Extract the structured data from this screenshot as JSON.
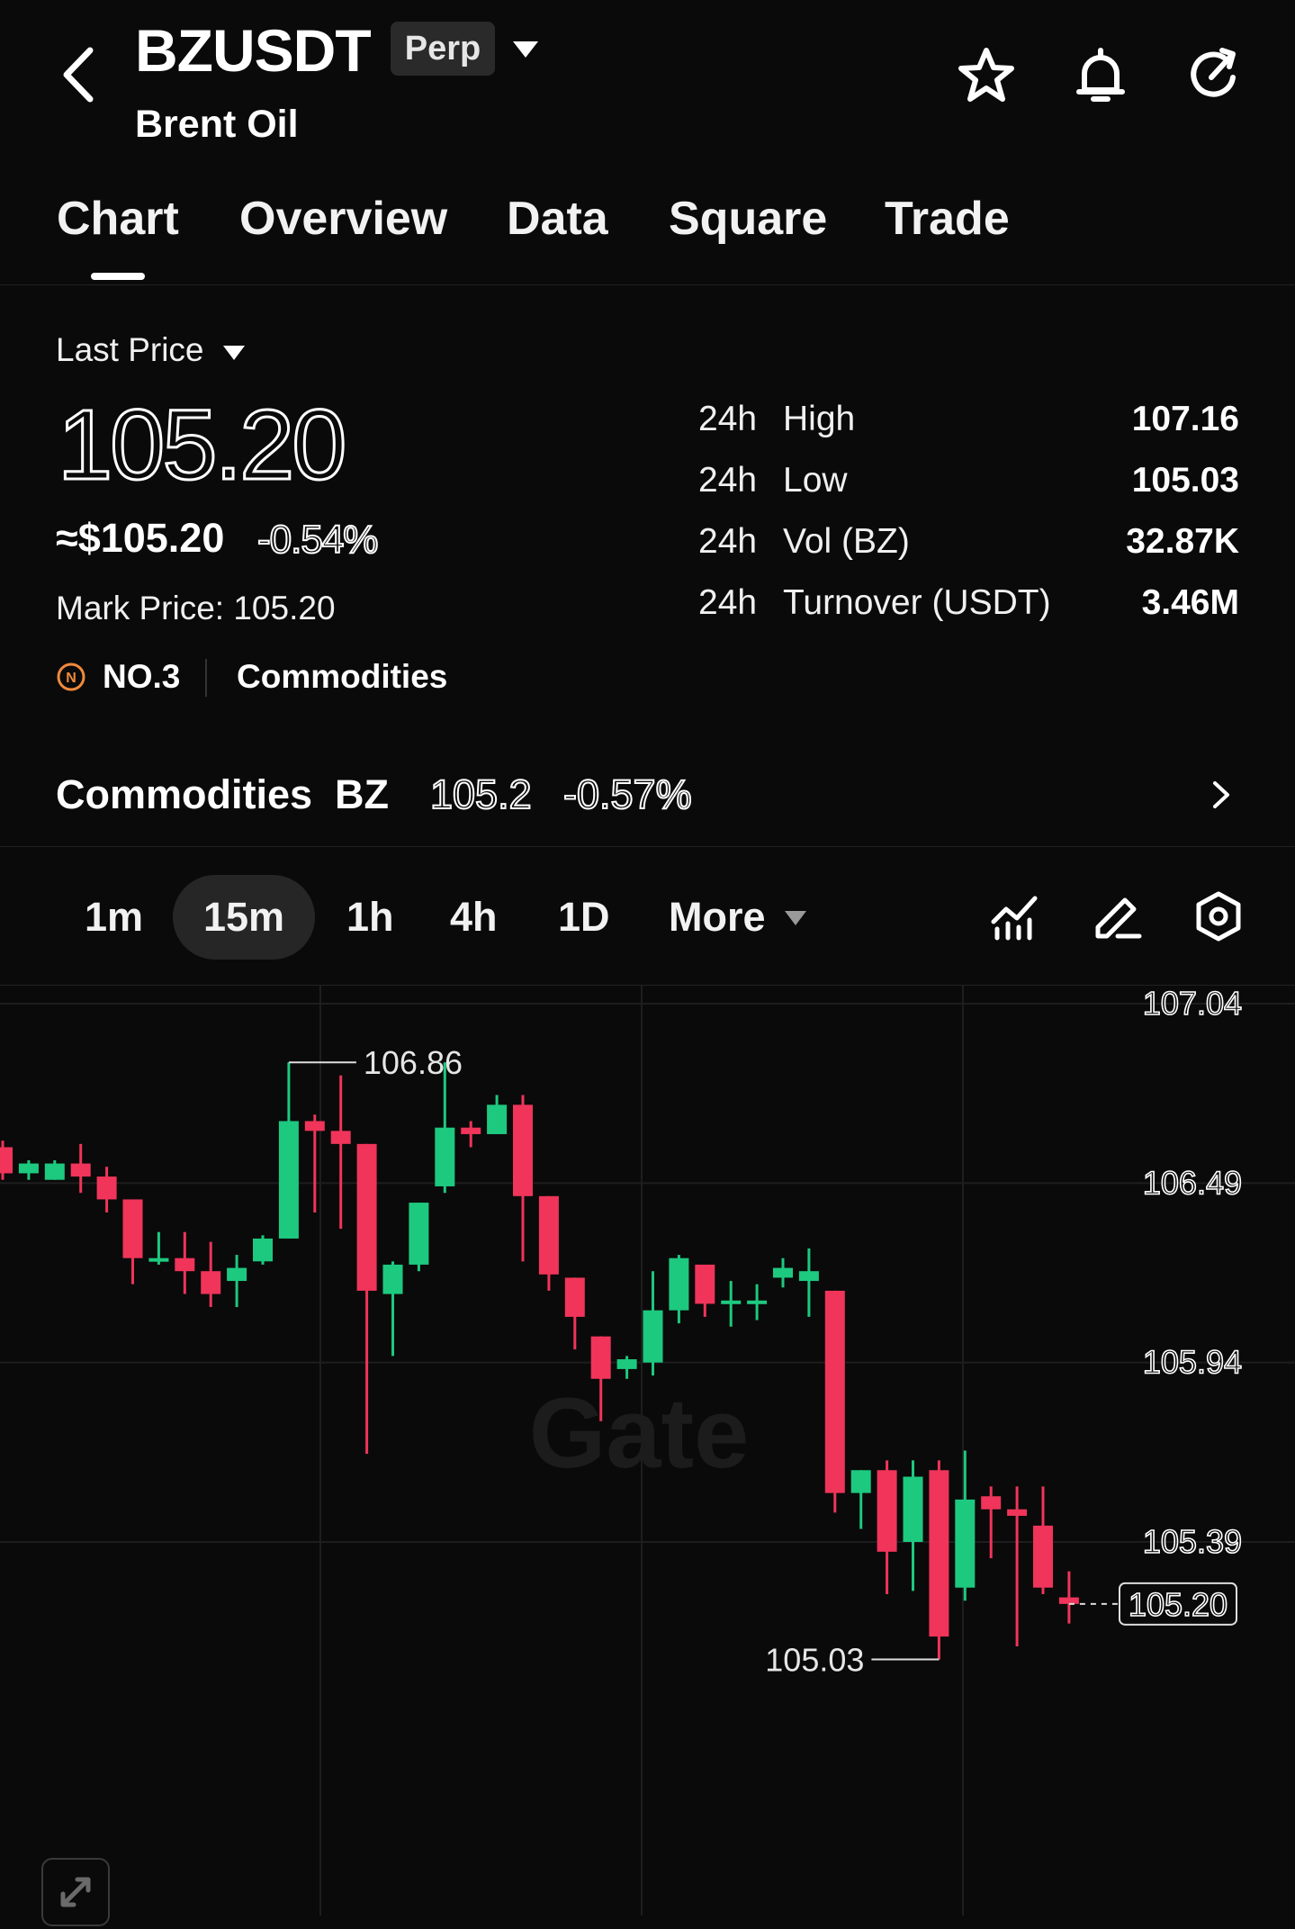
{
  "header": {
    "symbol": "BZUSDT",
    "badge": "Perp",
    "subtitle": "Brent Oil"
  },
  "tabs": [
    "Chart",
    "Overview",
    "Data",
    "Square",
    "Trade"
  ],
  "active_tab": "Chart",
  "price_panel": {
    "label": "Last Price",
    "last_price": "105.20",
    "approx": "≈$105.20",
    "change": "-0.54%",
    "mark_price": "Mark Price: 105.20",
    "rank": "NO.3",
    "category": "Commodities"
  },
  "stats": [
    {
      "prefix": "24h",
      "label": "High",
      "value": "107.16"
    },
    {
      "prefix": "24h",
      "label": "Low",
      "value": "105.03"
    },
    {
      "prefix": "24h",
      "label": "Vol (BZ)",
      "value": "32.87K"
    },
    {
      "prefix": "24h",
      "label": "Turnover (USDT)",
      "value": "3.46M"
    }
  ],
  "commodity_row": {
    "title": "Commodities",
    "symbol": "BZ",
    "price": "105.2",
    "change": "-0.57%"
  },
  "intervals": [
    "1m",
    "15m",
    "1h",
    "4h",
    "1D",
    "More"
  ],
  "active_interval": "15m",
  "icons": {
    "back": "chevron-left-icon",
    "caret": "caret-down-icon",
    "favorite": "star-icon",
    "alert": "bell-icon",
    "share": "share-refresh-icon",
    "rank": "rank-badge-icon",
    "arrow": "chevron-right-icon",
    "indicators": "indicator-chart-icon",
    "draw": "pencil-icon",
    "settings": "hexagon-settings-icon",
    "expand": "expand-icon"
  },
  "colors": {
    "background": "#0a0a0a",
    "up": "#1dc97f",
    "down": "#f0345a",
    "rank_accent": "#f08a3c"
  },
  "chart_data": {
    "type": "candlestick",
    "y_ticks": [
      "107.04",
      "106.49",
      "105.94",
      "105.39"
    ],
    "ylim": [
      104.9,
      107.08
    ],
    "high_label": "106.86",
    "low_label": "105.03",
    "current_label": "105.20",
    "current_value": 105.2,
    "watermark": "Gate",
    "candles": [
      {
        "o": 106.6,
        "h": 106.62,
        "l": 106.5,
        "c": 106.52
      },
      {
        "o": 106.52,
        "h": 106.56,
        "l": 106.5,
        "c": 106.55
      },
      {
        "o": 106.5,
        "h": 106.56,
        "l": 106.5,
        "c": 106.55
      },
      {
        "o": 106.55,
        "h": 106.61,
        "l": 106.46,
        "c": 106.51
      },
      {
        "o": 106.51,
        "h": 106.54,
        "l": 106.4,
        "c": 106.44
      },
      {
        "o": 106.44,
        "h": 106.44,
        "l": 106.18,
        "c": 106.26
      },
      {
        "o": 106.25,
        "h": 106.34,
        "l": 106.24,
        "c": 106.26
      },
      {
        "o": 106.26,
        "h": 106.34,
        "l": 106.15,
        "c": 106.22
      },
      {
        "o": 106.22,
        "h": 106.31,
        "l": 106.11,
        "c": 106.15
      },
      {
        "o": 106.19,
        "h": 106.27,
        "l": 106.11,
        "c": 106.23
      },
      {
        "o": 106.25,
        "h": 106.33,
        "l": 106.24,
        "c": 106.32
      },
      {
        "o": 106.32,
        "h": 106.86,
        "l": 106.32,
        "c": 106.68
      },
      {
        "o": 106.68,
        "h": 106.7,
        "l": 106.4,
        "c": 106.65
      },
      {
        "o": 106.65,
        "h": 106.82,
        "l": 106.35,
        "c": 106.61
      },
      {
        "o": 106.61,
        "h": 106.61,
        "l": 105.66,
        "c": 106.16
      },
      {
        "o": 106.15,
        "h": 106.25,
        "l": 105.96,
        "c": 106.24
      },
      {
        "o": 106.24,
        "h": 106.43,
        "l": 106.22,
        "c": 106.43
      },
      {
        "o": 106.48,
        "h": 106.86,
        "l": 106.46,
        "c": 106.66
      },
      {
        "o": 106.66,
        "h": 106.68,
        "l": 106.6,
        "c": 106.64
      },
      {
        "o": 106.64,
        "h": 106.76,
        "l": 106.64,
        "c": 106.73
      },
      {
        "o": 106.73,
        "h": 106.76,
        "l": 106.25,
        "c": 106.45
      },
      {
        "o": 106.45,
        "h": 106.45,
        "l": 106.16,
        "c": 106.21
      },
      {
        "o": 106.2,
        "h": 106.2,
        "l": 105.98,
        "c": 106.08
      },
      {
        "o": 106.02,
        "h": 106.02,
        "l": 105.76,
        "c": 105.89
      },
      {
        "o": 105.92,
        "h": 105.96,
        "l": 105.89,
        "c": 105.95
      },
      {
        "o": 105.94,
        "h": 106.22,
        "l": 105.9,
        "c": 106.1
      },
      {
        "o": 106.1,
        "h": 106.27,
        "l": 106.06,
        "c": 106.26
      },
      {
        "o": 106.24,
        "h": 106.24,
        "l": 106.08,
        "c": 106.12
      },
      {
        "o": 106.12,
        "h": 106.19,
        "l": 106.05,
        "c": 106.13
      },
      {
        "o": 106.13,
        "h": 106.18,
        "l": 106.07,
        "c": 106.13
      },
      {
        "o": 106.2,
        "h": 106.26,
        "l": 106.17,
        "c": 106.23
      },
      {
        "o": 106.19,
        "h": 106.29,
        "l": 106.08,
        "c": 106.22
      },
      {
        "o": 106.16,
        "h": 106.16,
        "l": 105.48,
        "c": 105.54
      },
      {
        "o": 105.54,
        "h": 105.61,
        "l": 105.43,
        "c": 105.61
      },
      {
        "o": 105.61,
        "h": 105.64,
        "l": 105.23,
        "c": 105.36
      },
      {
        "o": 105.39,
        "h": 105.64,
        "l": 105.24,
        "c": 105.59
      },
      {
        "o": 105.61,
        "h": 105.64,
        "l": 105.03,
        "c": 105.1
      },
      {
        "o": 105.25,
        "h": 105.67,
        "l": 105.21,
        "c": 105.52
      },
      {
        "o": 105.53,
        "h": 105.56,
        "l": 105.34,
        "c": 105.49
      },
      {
        "o": 105.49,
        "h": 105.56,
        "l": 105.07,
        "c": 105.47
      },
      {
        "o": 105.44,
        "h": 105.56,
        "l": 105.23,
        "c": 105.25
      },
      {
        "o": 105.22,
        "h": 105.3,
        "l": 105.14,
        "c": 105.2
      }
    ]
  }
}
